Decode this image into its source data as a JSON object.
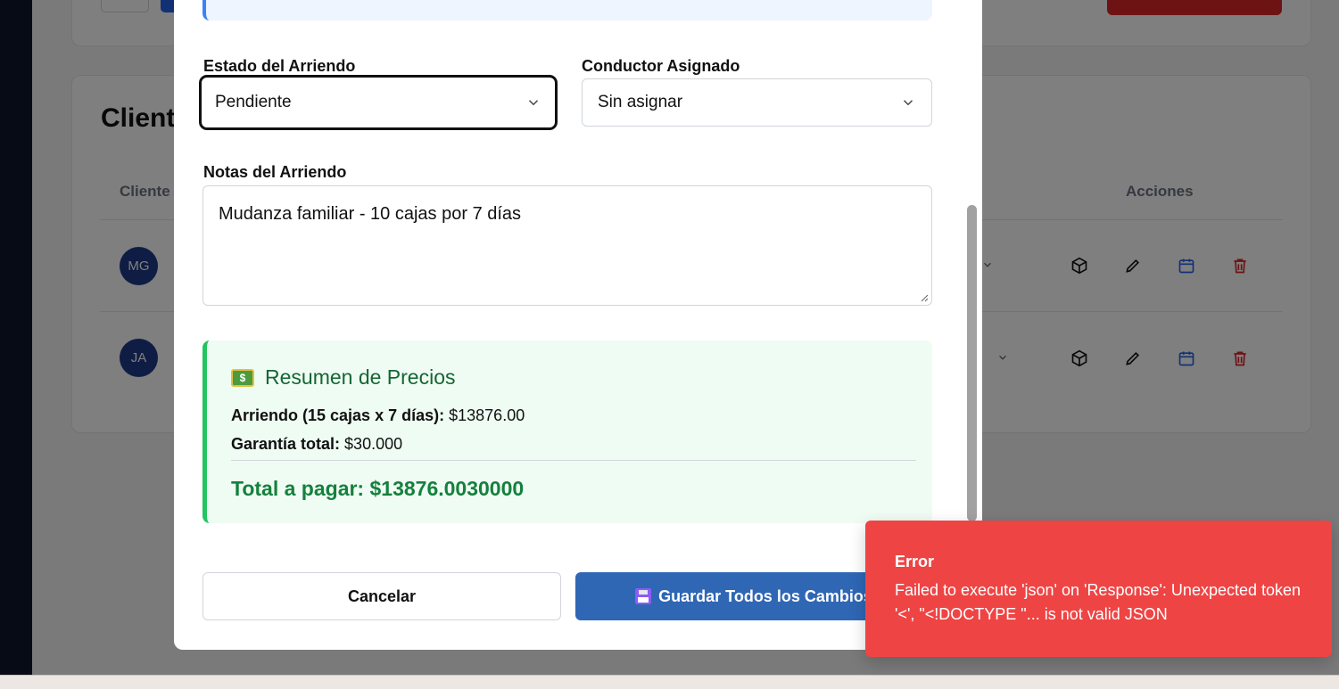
{
  "background": {
    "section_title": "Clientes",
    "table_header_client": "Cliente",
    "table_header_actions": "Acciones",
    "rows": [
      {
        "initials": "MG"
      },
      {
        "initials": "JA"
      }
    ]
  },
  "form": {
    "status_label": "Estado del Arriendo",
    "status_value": "Pendiente",
    "driver_label": "Conductor Asignado",
    "driver_value": "Sin asignar",
    "notes_label": "Notas del Arriendo",
    "notes_value": "Mudanza familiar - 10 cajas por 7 días"
  },
  "summary": {
    "icon": "money-icon",
    "title": "Resumen de Precios",
    "rental_label": "Arriendo (15 cajas x 7 días):",
    "rental_value": "$13876.00",
    "deposit_label": "Garantía total:",
    "deposit_value": "$30.000",
    "total_label": "Total a pagar: $13876.0030000"
  },
  "buttons": {
    "cancel": "Cancelar",
    "save": "Guardar Todos los Cambios"
  },
  "toast": {
    "title": "Error",
    "message": "Failed to execute 'json' on 'Response': Unexpected token '<', \"<!DOCTYPE \"... is not valid JSON"
  },
  "colors": {
    "primary": "#2f67b5",
    "success": "#15803d",
    "error": "#ef4444"
  }
}
